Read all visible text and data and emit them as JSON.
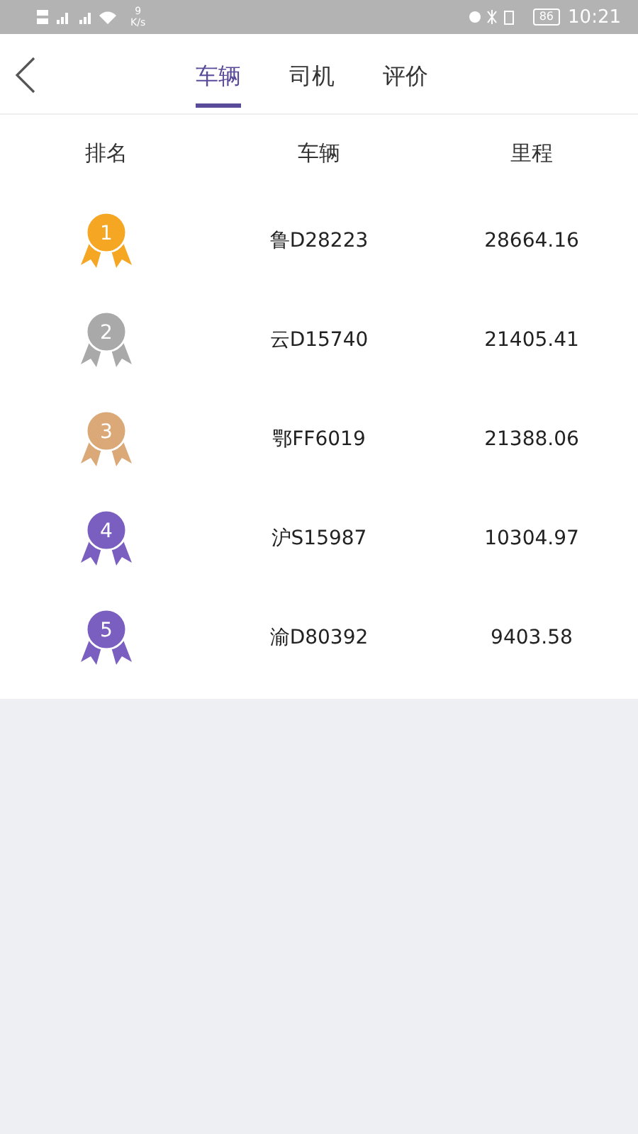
{
  "status_bar": {
    "speed": "9",
    "speed_unit": "K/s",
    "battery": "86",
    "time": "10:21"
  },
  "tabs": [
    {
      "label": "车辆",
      "selected": true
    },
    {
      "label": "司机",
      "selected": false
    },
    {
      "label": "评价",
      "selected": false
    }
  ],
  "table": {
    "columns": [
      "排名",
      "车辆",
      "里程"
    ],
    "rows": [
      {
        "rank": "1",
        "vehicle": "鲁D28223",
        "mileage": "28664.16",
        "color": "#f5a623"
      },
      {
        "rank": "2",
        "vehicle": "云D15740",
        "mileage": "21405.41",
        "color": "#a9a9a9"
      },
      {
        "rank": "3",
        "vehicle": "鄂FF6019",
        "mileage": "21388.06",
        "color": "#dba977"
      },
      {
        "rank": "4",
        "vehicle": "沪S15987",
        "mileage": "10304.97",
        "color": "#7b5fc0"
      },
      {
        "rank": "5",
        "vehicle": "渝D80392",
        "mileage": "9403.58",
        "color": "#7b5fc0"
      }
    ]
  }
}
